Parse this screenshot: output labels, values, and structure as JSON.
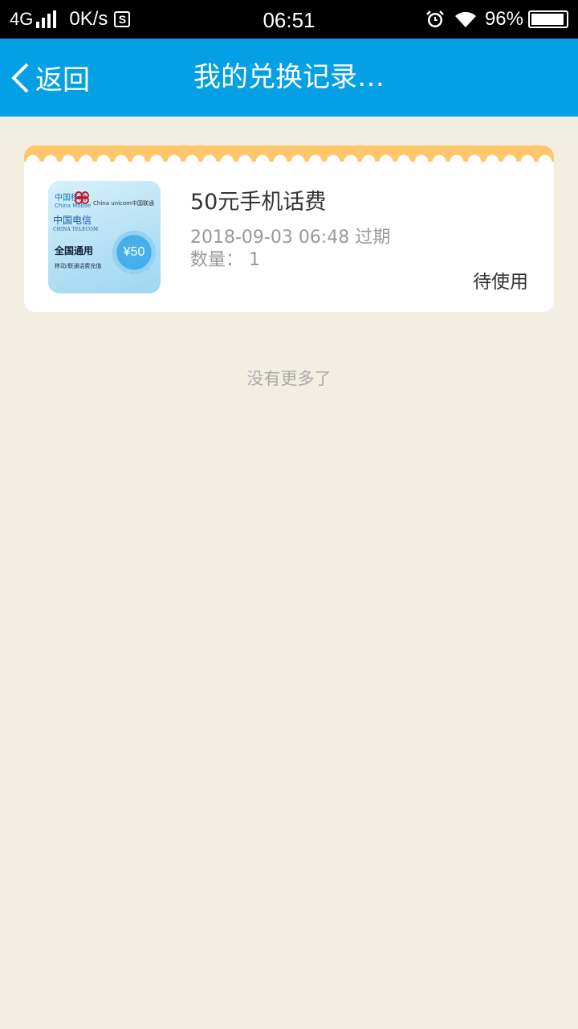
{
  "status_bar": {
    "network": "4G",
    "speed": "0K/s",
    "s_icon_letter": "S",
    "time": "06:51",
    "battery_percent": "96%",
    "battery_level": 0.96,
    "icons": [
      "signal-icon",
      "s-badge-icon",
      "alarm-icon",
      "wifi-icon",
      "battery-icon"
    ]
  },
  "header": {
    "back_label": "返回",
    "title": "我的兑换记录…",
    "background_color": "#04a0e6"
  },
  "records": [
    {
      "title": "50元手机话费",
      "date_line": "2018-09-03 06:48 过期",
      "quantity_line": "数量：  1",
      "status": "待使用",
      "thumbnail": {
        "china_mobile": "中国移动",
        "china_mobile_en": "China Mobile",
        "china_telecom": "中国电信",
        "china_telecom_en": "CHINA TELECOM",
        "china_unicom": "China unicom中国联通",
        "nationwide": "全国通用",
        "subtitle": "移动/联通话费充值",
        "amount": "¥50"
      }
    }
  ],
  "footer_text": "没有更多了",
  "colors": {
    "page_background": "#f3eee2",
    "card_top_band": "#ffc76a"
  }
}
